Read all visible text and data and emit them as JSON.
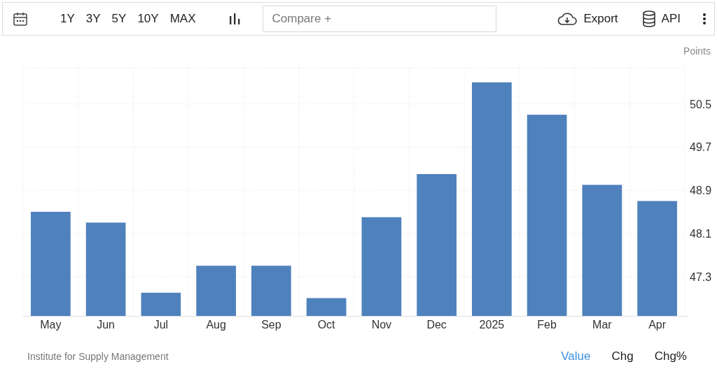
{
  "toolbar": {
    "ranges": [
      {
        "label": "1Y",
        "selected": false
      },
      {
        "label": "3Y",
        "selected": false
      },
      {
        "label": "5Y",
        "selected": false
      },
      {
        "label": "10Y",
        "selected": false
      },
      {
        "label": "MAX",
        "selected": false
      }
    ],
    "compare": {
      "placeholder": "Compare +"
    },
    "export": "Export",
    "api": "API"
  },
  "chart": {
    "unit": "Points",
    "chart_data": {
      "type": "bar",
      "categories": [
        "May",
        "Jun",
        "Jul",
        "Aug",
        "Sep",
        "Oct",
        "Nov",
        "Dec",
        "2025",
        "Feb",
        "Mar",
        "Apr"
      ],
      "grid": true,
      "series": [
        {
          "color": "#4f81bd",
          "values": [
            48.5,
            48.3,
            47.0,
            47.5,
            47.5,
            46.9,
            48.4,
            49.2,
            50.9,
            50.3,
            49.0,
            48.7
          ]
        }
      ],
      "ylim": [
        46.57,
        51.17
      ],
      "yticks": [
        47.3,
        48.1,
        48.9,
        49.7,
        50.5
      ]
    }
  },
  "footer": {
    "source": "Institute for Supply Management",
    "views": [
      {
        "label": "Value",
        "selected": true
      },
      {
        "label": "Chg",
        "selected": false
      },
      {
        "label": "Chg%",
        "selected": false
      }
    ]
  }
}
